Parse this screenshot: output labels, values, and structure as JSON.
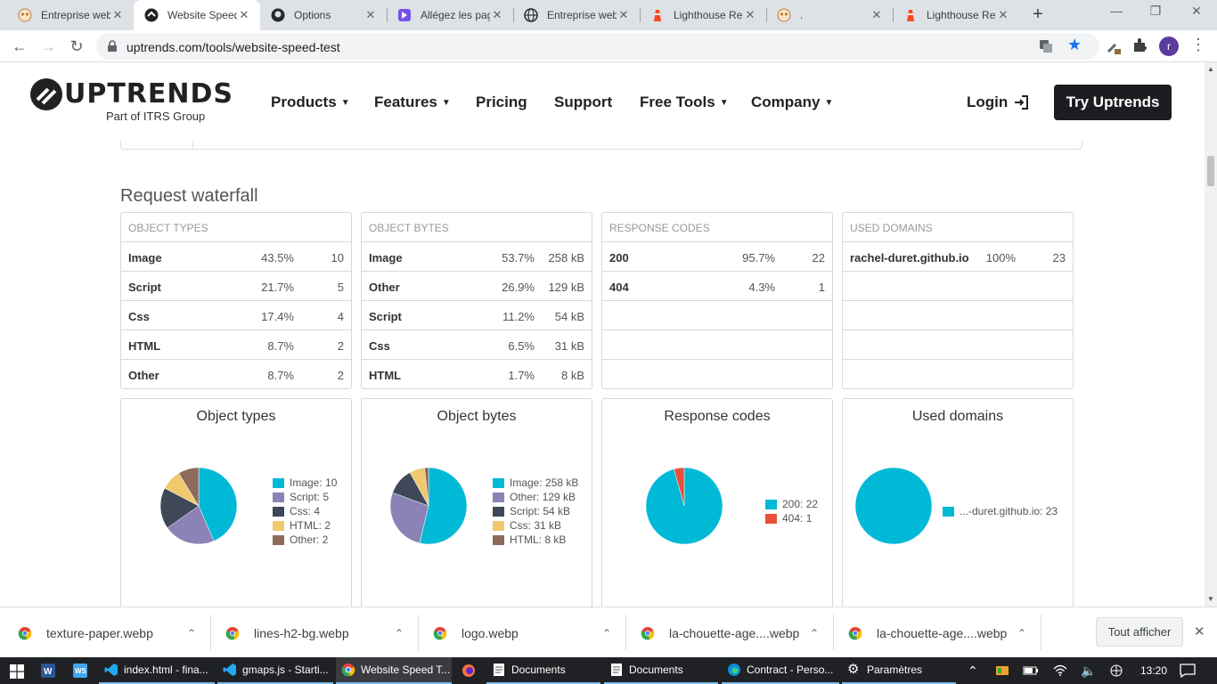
{
  "browser": {
    "tabs": [
      {
        "title": "Entreprise web",
        "icon": "owl-favicon-icon",
        "active": false
      },
      {
        "title": "Website Speed",
        "icon": "uptrends-favicon-icon",
        "active": true
      },
      {
        "title": "Options",
        "icon": "github-favicon-icon",
        "active": false
      },
      {
        "title": "Allégez les pag",
        "icon": "openclassrooms-favicon-icon",
        "active": false
      },
      {
        "title": "Entreprise web",
        "icon": "globe-favicon-icon",
        "active": false
      },
      {
        "title": "Lighthouse Rep",
        "icon": "lighthouse-favicon-icon",
        "active": false
      },
      {
        "title": ".",
        "icon": "owl-favicon-icon",
        "active": false
      },
      {
        "title": "Lighthouse Rep",
        "icon": "lighthouse-favicon-icon",
        "active": false
      }
    ],
    "url": "uptrends.com/tools/website-speed-test",
    "profile_initial": "r"
  },
  "site": {
    "logo_text": "UPTRENDS",
    "logo_sub": "Part of ITRS Group",
    "nav": [
      {
        "label": "Products",
        "dropdown": true
      },
      {
        "label": "Features",
        "dropdown": true
      },
      {
        "label": "Pricing",
        "dropdown": false
      },
      {
        "label": "Support",
        "dropdown": false
      },
      {
        "label": "Free Tools",
        "dropdown": true
      },
      {
        "label": "Company",
        "dropdown": true
      }
    ],
    "login": "Login",
    "cta": "Try Uptrends"
  },
  "waterfall": {
    "title": "Request waterfall",
    "tables": [
      {
        "header": "OBJECT TYPES",
        "rows": [
          {
            "name": "Image",
            "pct": "43.5%",
            "count": "10"
          },
          {
            "name": "Script",
            "pct": "21.7%",
            "count": "5"
          },
          {
            "name": "Css",
            "pct": "17.4%",
            "count": "4"
          },
          {
            "name": "HTML",
            "pct": "8.7%",
            "count": "2"
          },
          {
            "name": "Other",
            "pct": "8.7%",
            "count": "2"
          }
        ]
      },
      {
        "header": "OBJECT BYTES",
        "rows": [
          {
            "name": "Image",
            "pct": "53.7%",
            "count": "258 kB"
          },
          {
            "name": "Other",
            "pct": "26.9%",
            "count": "129 kB"
          },
          {
            "name": "Script",
            "pct": "11.2%",
            "count": "54 kB"
          },
          {
            "name": "Css",
            "pct": "6.5%",
            "count": "31 kB"
          },
          {
            "name": "HTML",
            "pct": "1.7%",
            "count": "8 kB"
          }
        ]
      },
      {
        "header": "RESPONSE CODES",
        "rows": [
          {
            "name": "200",
            "pct": "95.7%",
            "count": "22"
          },
          {
            "name": "404",
            "pct": "4.3%",
            "count": "1"
          },
          {
            "name": "",
            "pct": "",
            "count": ""
          },
          {
            "name": "",
            "pct": "",
            "count": ""
          },
          {
            "name": "",
            "pct": "",
            "count": ""
          }
        ]
      },
      {
        "header": "USED DOMAINS",
        "rows": [
          {
            "name": "rachel-duret.github.io",
            "pct": "100%",
            "count": "23"
          },
          {
            "name": "",
            "pct": "",
            "count": ""
          },
          {
            "name": "",
            "pct": "",
            "count": ""
          },
          {
            "name": "",
            "pct": "",
            "count": ""
          },
          {
            "name": "",
            "pct": "",
            "count": ""
          }
        ]
      }
    ],
    "colors": {
      "image": "#00b9d6",
      "script": "#8b83b6",
      "css": "#3e4858",
      "html": "#f0c86e",
      "other": "#8d6a5a",
      "r404": "#e8503a"
    }
  },
  "chart_data": [
    {
      "type": "pie",
      "title": "Object types",
      "categories": [
        "Image",
        "Script",
        "Css",
        "HTML",
        "Other"
      ],
      "values": [
        10,
        5,
        4,
        2,
        2
      ],
      "legend": [
        "Image: 10",
        "Script: 5",
        "Css: 4",
        "HTML: 2",
        "Other: 2"
      ],
      "colors": [
        "#00b9d6",
        "#8b83b6",
        "#3e4858",
        "#f0c86e",
        "#8d6a5a"
      ]
    },
    {
      "type": "pie",
      "title": "Object bytes",
      "categories": [
        "Image",
        "Other",
        "Script",
        "Css",
        "HTML"
      ],
      "values": [
        258,
        129,
        54,
        31,
        8
      ],
      "legend": [
        "Image: 258 kB",
        "Other: 129 kB",
        "Script: 54 kB",
        "Css: 31 kB",
        "HTML: 8 kB"
      ],
      "colors": [
        "#00b9d6",
        "#8b83b6",
        "#3e4858",
        "#f0c86e",
        "#8d6a5a"
      ]
    },
    {
      "type": "pie",
      "title": "Response codes",
      "categories": [
        "200",
        "404"
      ],
      "values": [
        22,
        1
      ],
      "legend": [
        "200: 22",
        "404: 1"
      ],
      "colors": [
        "#00b9d6",
        "#e8503a"
      ]
    },
    {
      "type": "pie",
      "title": "Used domains",
      "categories": [
        "rachel-duret.github.io"
      ],
      "values": [
        23
      ],
      "legend": [
        "...-duret.github.io: 23"
      ],
      "colors": [
        "#00b9d6"
      ]
    }
  ],
  "downloads": {
    "items": [
      "texture-paper.webp",
      "lines-h2-bg.webp",
      "logo.webp",
      "la-chouette-age....webp",
      "la-chouette-age....webp"
    ],
    "show_all": "Tout afficher"
  },
  "taskbar": {
    "apps": [
      {
        "label": "",
        "icon": "word-icon"
      },
      {
        "label": "",
        "icon": "word-alt-icon"
      },
      {
        "label": "index.html - fina...",
        "icon": "vscode-icon"
      },
      {
        "label": "gmaps.js - Starti...",
        "icon": "vscode-icon"
      },
      {
        "label": "Website Speed T...",
        "icon": "chrome-icon"
      },
      {
        "label": "",
        "icon": "firefox-icon"
      },
      {
        "label": "Documents",
        "icon": "document-icon"
      },
      {
        "label": "Documents",
        "icon": "document-icon"
      },
      {
        "label": "Contract - Perso...",
        "icon": "edge-icon"
      },
      {
        "label": "Paramètres",
        "icon": "settings-gear-icon"
      }
    ],
    "time": "13:20"
  }
}
